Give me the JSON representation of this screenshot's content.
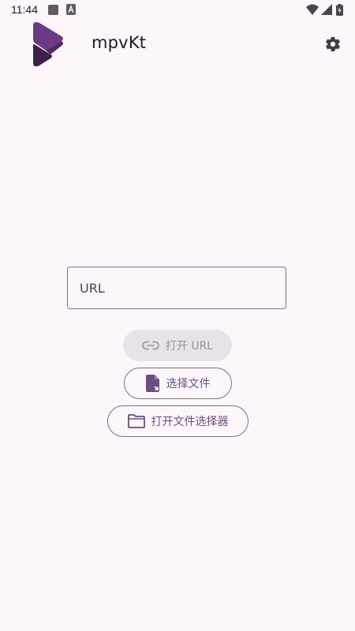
{
  "status_bar": {
    "time": "11:44",
    "icons": [
      "notification-square-icon",
      "accessibility-a-icon",
      "wifi-icon",
      "signal-icon",
      "battery-icon"
    ]
  },
  "app_bar": {
    "title": "mpvKt",
    "logo_icon": "mpvkt-logo-icon",
    "settings_icon": "gear-icon"
  },
  "url_input": {
    "placeholder": "URL",
    "value": ""
  },
  "buttons": {
    "open_url": {
      "label": "打开 URL",
      "icon": "link-icon",
      "enabled": false
    },
    "pick_file": {
      "label": "选择文件",
      "icon": "file-icon"
    },
    "open_picker": {
      "label": "打开文件选择器",
      "icon": "folder-icon"
    }
  },
  "colors": {
    "background": "#fdf7fc",
    "primary": "#6b4e7c",
    "outline": "#79747e",
    "disabled_container": "#e9e2e8",
    "logo_dark": "#3c1f4a",
    "logo_light": "#6b3a85"
  }
}
